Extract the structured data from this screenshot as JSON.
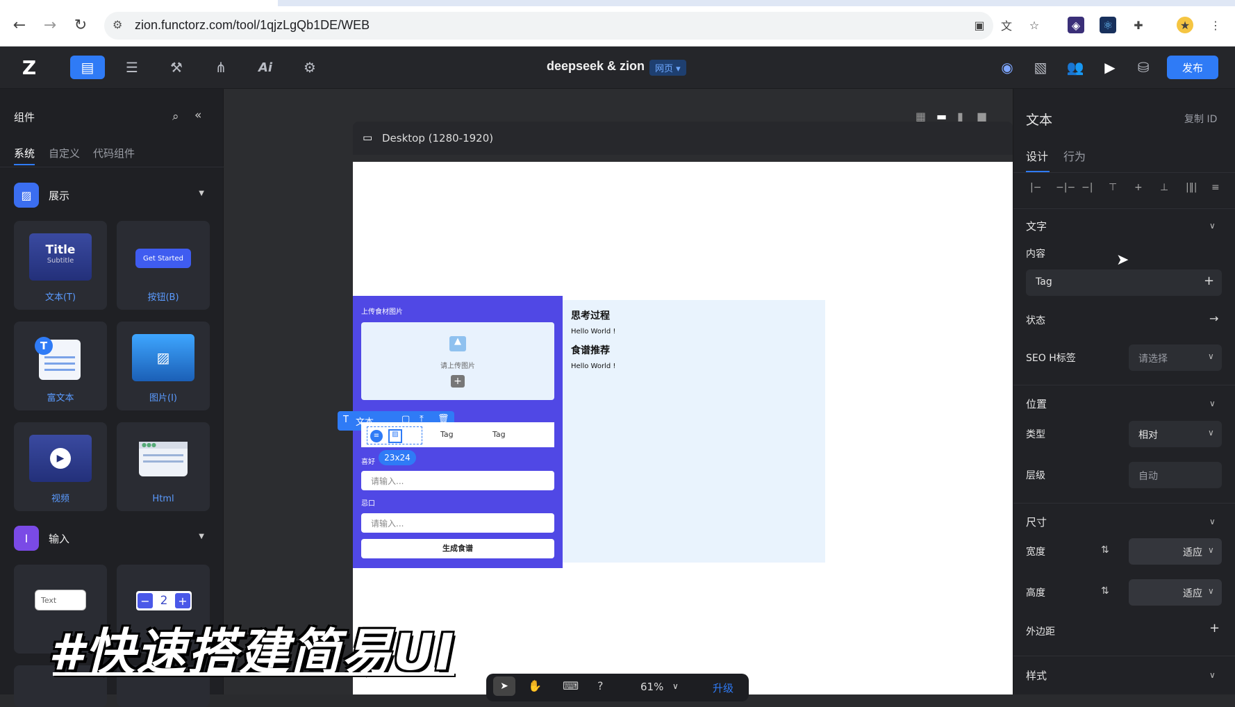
{
  "browser": {
    "url": "zion.functorz.com/tool/1qjzLgQb1DE/WEB"
  },
  "toolbar": {
    "project_title": "deepseek & zion",
    "platform_badge": "网页 ▾",
    "publish_label": "发布"
  },
  "left_panel": {
    "title": "组件",
    "tabs": [
      "系统",
      "自定义",
      "代码组件"
    ],
    "sections": [
      {
        "label": "展示",
        "items": [
          "文本(T)",
          "按钮(B)",
          "富文本",
          "图片(I)",
          "视频",
          "Html"
        ]
      },
      {
        "label": "输入"
      }
    ],
    "thumb_text": {
      "title_main": "Title",
      "title_sub": "Subtitle",
      "button": "Get Started",
      "input_text": "Text",
      "stepper_value": "2",
      "richtext_badge": "T"
    }
  },
  "canvas": {
    "device_label": "Desktop (1280-1920)",
    "form": {
      "upload_label": "上传食材图片",
      "upload_hint": "请上传图片",
      "tags": [
        "Tag",
        "Tag"
      ],
      "size_badge": "23x24",
      "toolbar_label": "文本",
      "pref_label": "喜好",
      "avoid_label": "忌口",
      "input_placeholder": "请输入...",
      "submit_label": "生成食谱"
    },
    "output": {
      "heading1": "思考过程",
      "text1": "Hello World !",
      "heading2": "食谱推荐",
      "text2": "Hello World !"
    }
  },
  "right_panel": {
    "title": "文本",
    "copy_id": "复制 ID",
    "tabs": [
      "设计",
      "行为"
    ],
    "text_section": "文字",
    "content_label": "内容",
    "content_value": "Tag",
    "state_label": "状态",
    "seo_label": "SEO H标签",
    "seo_placeholder": "请选择",
    "position_section": "位置",
    "type_label": "类型",
    "type_value": "相对",
    "z_label": "层级",
    "z_value": "自动",
    "size_section": "尺寸",
    "width_label": "宽度",
    "width_value": "适应",
    "height_label": "高度",
    "height_value": "适应",
    "margin_label": "外边距",
    "style_section": "样式"
  },
  "bottom_toolbar": {
    "zoom": "61%",
    "upgrade": "升级"
  },
  "overlay": {
    "caption": "#快速搭建简易UI"
  },
  "colors": {
    "accent": "#2f7bf6",
    "form_bg": "#5048e5",
    "output_bg": "#e9f3fd"
  }
}
